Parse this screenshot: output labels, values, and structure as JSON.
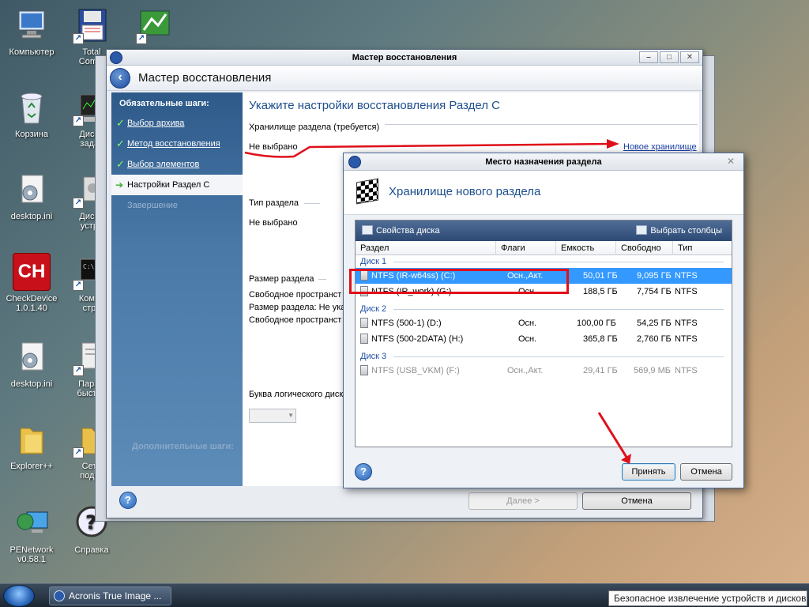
{
  "desktop": {
    "icons": [
      {
        "label": "Компьютер",
        "icon": "computer-icon"
      },
      {
        "label": "Total\nComm",
        "icon": "floppy-icon"
      },
      {
        "label": "",
        "icon": "map-app-icon"
      },
      {
        "label": "Корзина",
        "icon": "recycle-bin-icon"
      },
      {
        "label": "Диспе\nзадач",
        "icon": "task-manager-icon"
      },
      {
        "label": "desktop.ini",
        "icon": "settings-file-icon"
      },
      {
        "label": "Диспе\nустро",
        "icon": "device-manager-icon"
      },
      {
        "label": "CheckDevice\n1.0.1.40",
        "icon": "checkdevice-icon"
      },
      {
        "label": "Коман\nстро",
        "icon": "cmd-icon"
      },
      {
        "label": "desktop.ini",
        "icon": "settings-file-icon"
      },
      {
        "label": "Парам\nбыстро",
        "icon": "params-icon"
      },
      {
        "label": "Explorer++",
        "icon": "folder-icon"
      },
      {
        "label": "Сете\nподкл",
        "icon": "network-folder-icon"
      },
      {
        "label": "PENetwork\nv0.58.1",
        "icon": "network-icon"
      },
      {
        "label": "Справка",
        "icon": "help-icon"
      }
    ],
    "checkdevice_glyph": "CH"
  },
  "main_window": {
    "title": "Мастер восстановления",
    "header_title": "Мастер восстановления",
    "sidebar": {
      "heading": "Обязательные шаги:",
      "items": [
        {
          "label": "Выбор архива",
          "state": "done"
        },
        {
          "label": "Метод восстановления",
          "state": "done"
        },
        {
          "label": "Выбор элементов",
          "state": "done"
        },
        {
          "label": "Настройки Раздел C",
          "state": "active"
        },
        {
          "label": "Завершение",
          "state": "disabled"
        }
      ],
      "faint_label": "Дополнительные шаги:"
    },
    "content": {
      "title": "Укажите настройки восстановления Раздел C",
      "storage_label": "Хранилище раздела (требуется)",
      "storage_value": "Не выбрано",
      "new_storage_link": "Новое хранилище",
      "partition_type_label": "Тип раздела",
      "partition_type_value": "Не выбрано",
      "size_label": "Размер раздела",
      "free_before": "Свободное пространст",
      "size_value": "Размер раздела: Не ука",
      "free_after": "Свободное пространст",
      "drive_letter_label": "Буква логического диск"
    },
    "footer": {
      "next_label": "Далее >",
      "cancel_label": "Отмена"
    }
  },
  "dialog": {
    "title": "Место назначения раздела",
    "header": "Хранилище нового раздела",
    "toolbar": {
      "disk_props": "Свойства диска",
      "choose_columns": "Выбрать столбцы"
    },
    "columns": [
      "Раздел",
      "Флаги",
      "Емкость",
      "Свободно",
      "Тип"
    ],
    "groups": [
      {
        "label": "Диск 1",
        "rows": [
          {
            "name": "NTFS (IR-w64ss) (C:)",
            "flags": "Осн.,Акт.",
            "capacity": "50,01 ГБ",
            "free": "9,095 ГБ",
            "type": "NTFS",
            "selected": true
          },
          {
            "name": "NTFS (IR_work) (G:)",
            "flags": "Осн.",
            "capacity": "188,5 ГБ",
            "free": "7,754 ГБ",
            "type": "NTFS"
          }
        ]
      },
      {
        "label": "Диск 2",
        "rows": [
          {
            "name": "NTFS (500-1) (D:)",
            "flags": "Осн.",
            "capacity": "100,00 ГБ",
            "free": "54,25 ГБ",
            "type": "NTFS"
          },
          {
            "name": "NTFS (500-2DATA) (H:)",
            "flags": "Осн.",
            "capacity": "365,8 ГБ",
            "free": "2,760 ГБ",
            "type": "NTFS"
          }
        ]
      },
      {
        "label": "Диск 3",
        "rows": [
          {
            "name": "NTFS (USB_VKM) (F:)",
            "flags": "Осн.,Акт.",
            "capacity": "29,41 ГБ",
            "free": "569,9 МБ",
            "type": "NTFS",
            "dimmed": true
          }
        ]
      }
    ],
    "accept_label": "Принять",
    "cancel_label": "Отмена"
  },
  "taskbar": {
    "task_label": "Acronis True Image ...",
    "tooltip": "Безопасное извлечение устройств и дисков"
  },
  "colors": {
    "accent_title": "#1e4f8c",
    "selection": "#3399ff",
    "annotation_red": "#e0101a"
  }
}
